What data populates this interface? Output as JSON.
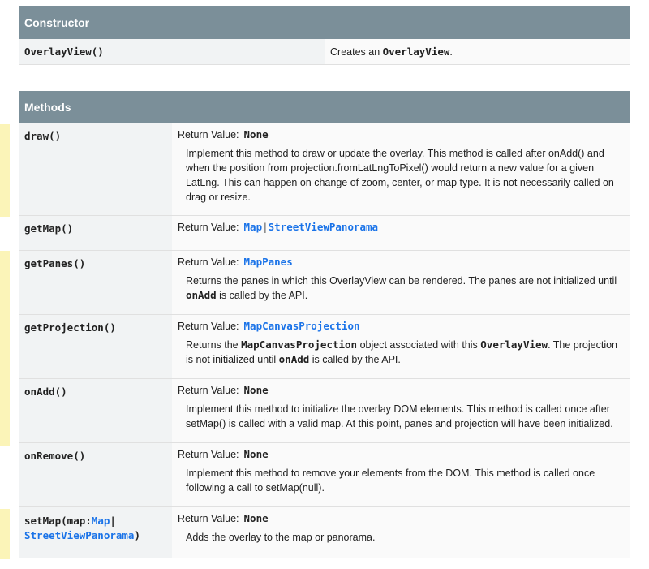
{
  "constructor": {
    "title": "Constructor",
    "name": "OverlayView()",
    "desc_pre": "Creates an ",
    "desc_code": "OverlayView",
    "desc_post": "."
  },
  "methods": {
    "title": "Methods",
    "return_label": "Return Value:",
    "rows": [
      {
        "name": "draw()",
        "return": "None",
        "desc": "Implement this method to draw or update the overlay. This method is called after onAdd() and when the position from projection.fromLatLngToPixel() would return a new value for a given LatLng. This can happen on change of zoom, center, or map type. It is not necessarily called on drag or resize."
      },
      {
        "name": "getMap()",
        "return_a": "Map",
        "return_sep": "|",
        "return_b": "StreetViewPanorama"
      },
      {
        "name": "getPanes()",
        "return": "MapPanes",
        "desc_pre": "Returns the panes in which this OverlayView can be rendered. The panes are not initialized until ",
        "desc_code": "onAdd",
        "desc_post": " is called by the API."
      },
      {
        "name": "getProjection()",
        "return": "MapCanvasProjection",
        "desc_pre": "Returns the ",
        "desc_code": "MapCanvasProjection",
        "desc_mid": " object associated with this ",
        "desc_code2": "OverlayView",
        "desc_mid2": ". The projection is not initialized until ",
        "desc_code3": "onAdd",
        "desc_post": " is called by the API."
      },
      {
        "name": "onAdd()",
        "return": "None",
        "desc": "Implement this method to initialize the overlay DOM elements. This method is called once after setMap() is called with a valid map. At this point, panes and projection will have been initialized."
      },
      {
        "name": "onRemove()",
        "return": "None",
        "desc": "Implement this method to remove your elements from the DOM. This method is called once following a call to setMap(null)."
      },
      {
        "name_pre": "setMap(map:",
        "name_link1": "Map",
        "name_sep": "|",
        "name_link2": "StreetViewPanorama",
        "name_post": ")",
        "return": "None",
        "desc": "Adds the overlay to the map or panorama."
      }
    ]
  },
  "colors": {
    "header_bg": "#7b8f99",
    "link": "#1a73e8",
    "marker": "#fbf4b8"
  }
}
